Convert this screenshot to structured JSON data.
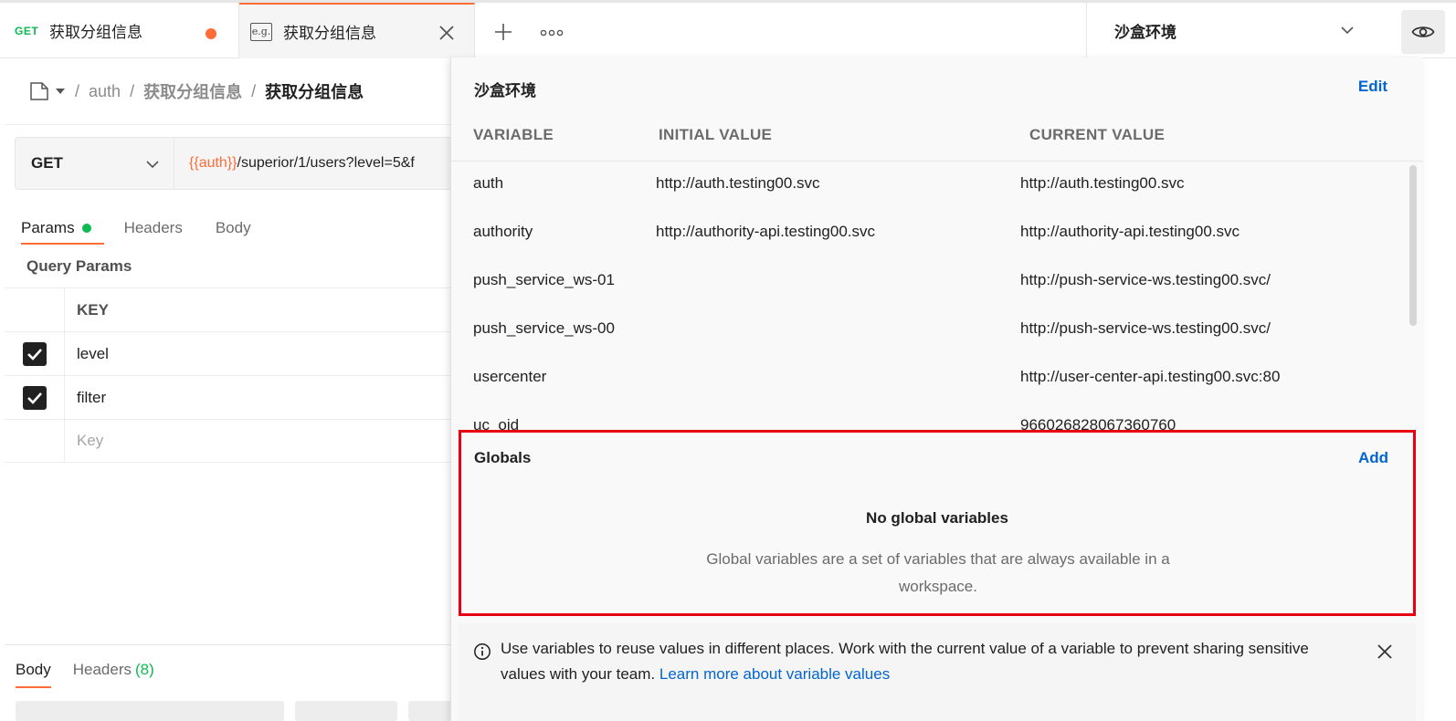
{
  "tabs": [
    {
      "method": "GET",
      "title": "获取分组信息",
      "unsaved": true
    },
    {
      "icon": "e.g.",
      "title": "获取分组信息"
    }
  ],
  "environment": {
    "selected": "沙盒环境"
  },
  "breadcrumb": {
    "collection": "auth",
    "folder": "获取分组信息",
    "current": "获取分组信息",
    "sep": "/"
  },
  "request": {
    "method": "GET",
    "url_variable": "{{auth}}",
    "url_path": "/superior/1/users?level=5&f",
    "tabs": {
      "params": "Params",
      "headers": "Headers",
      "body": "Body"
    },
    "query_params_title": "Query Params",
    "params_header_key": "KEY",
    "params": [
      {
        "key": "level",
        "checked": true
      },
      {
        "key": "filter",
        "checked": true
      }
    ],
    "key_placeholder": "Key"
  },
  "response": {
    "tabs": {
      "body": "Body",
      "headers": "Headers",
      "headers_count": "(8)"
    }
  },
  "popover": {
    "title": "沙盒环境",
    "edit_label": "Edit",
    "columns": {
      "variable": "VARIABLE",
      "initial": "INITIAL VALUE",
      "current": "CURRENT VALUE"
    },
    "variables": [
      {
        "name": "auth",
        "initial": "http://auth.testing00.svc",
        "current": "http://auth.testing00.svc"
      },
      {
        "name": "authority",
        "initial": "http://authority-api.testing00.svc",
        "current": "http://authority-api.testing00.svc"
      },
      {
        "name": "push_service_ws-01",
        "initial": "",
        "current": "http://push-service-ws.testing00.svc/"
      },
      {
        "name": "push_service_ws-00",
        "initial": "",
        "current": "http://push-service-ws.testing00.svc/"
      },
      {
        "name": "usercenter",
        "initial": "",
        "current": "http://user-center-api.testing00.svc:80"
      },
      {
        "name": "uc_oid",
        "initial": "",
        "current": "966026828067360760"
      }
    ],
    "globals": {
      "title": "Globals",
      "add_label": "Add",
      "empty_title": "No global variables",
      "empty_desc": "Global variables are a set of variables that are always available in a workspace."
    },
    "info": {
      "text": "Use variables to reuse values in different places. Work with the current value of a variable to prevent sharing sensitive values with your team.",
      "link": "Learn more about variable values"
    }
  },
  "colors": {
    "accent": "#ff6c37",
    "link": "#0265d2",
    "success": "#0cbb52",
    "highlight_border": "#e60012"
  }
}
